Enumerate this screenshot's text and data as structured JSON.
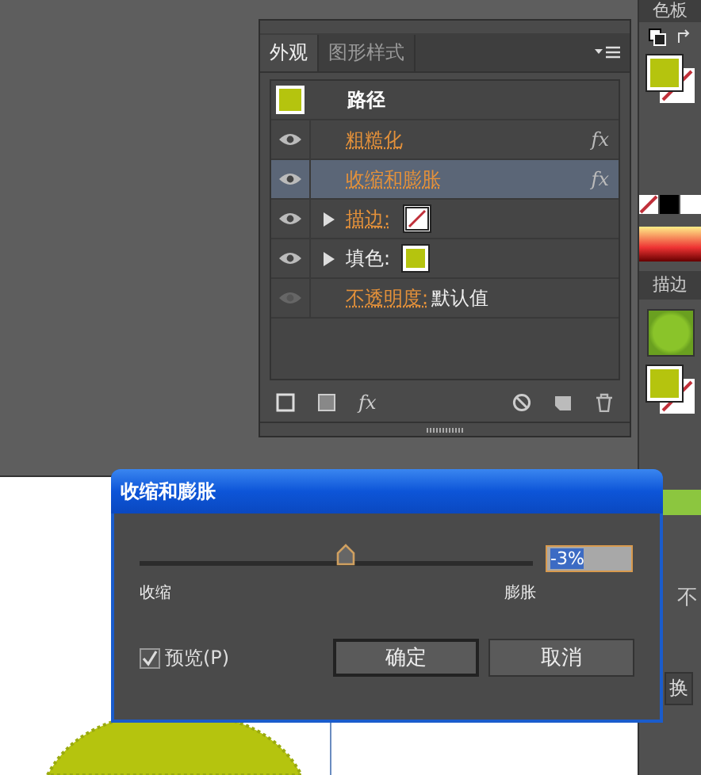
{
  "appearance_panel": {
    "tabs": [
      {
        "label": "外观",
        "selected": true
      },
      {
        "label": "图形样式",
        "selected": false
      }
    ],
    "header": {
      "label": "路径",
      "color": "#b5c40e"
    },
    "rows": [
      {
        "kind": "effect",
        "label": "粗糙化",
        "fx": "fx",
        "selected": false,
        "visible": true
      },
      {
        "kind": "effect",
        "label": "收缩和膨胀",
        "fx": "fx",
        "selected": true,
        "visible": true
      },
      {
        "kind": "stroke",
        "label": "描边:",
        "selected": false,
        "visible": true
      },
      {
        "kind": "fill",
        "label": "填色:",
        "color": "#b5c40e",
        "selected": false,
        "visible": true
      },
      {
        "kind": "opacity",
        "label": "不透明度:",
        "value": "默认值",
        "selected": false,
        "visible": false
      }
    ],
    "footer_fx": "fx"
  },
  "right_dock": {
    "swatches_title": "色板",
    "stroke_title": "描边",
    "fill_swatch": {
      "color": "#b5c40e"
    },
    "cut_texts": [
      "不",
      "换"
    ]
  },
  "dialog": {
    "title": "收缩和膨胀",
    "slider": {
      "level": 0.5,
      "value": "-3%",
      "min_label": "收缩",
      "max_label": "膨胀"
    },
    "preview": {
      "label": "预览(P)",
      "checked": true
    },
    "buttons": [
      {
        "label": "确定",
        "default": true
      },
      {
        "label": "取消",
        "default": false
      }
    ]
  }
}
